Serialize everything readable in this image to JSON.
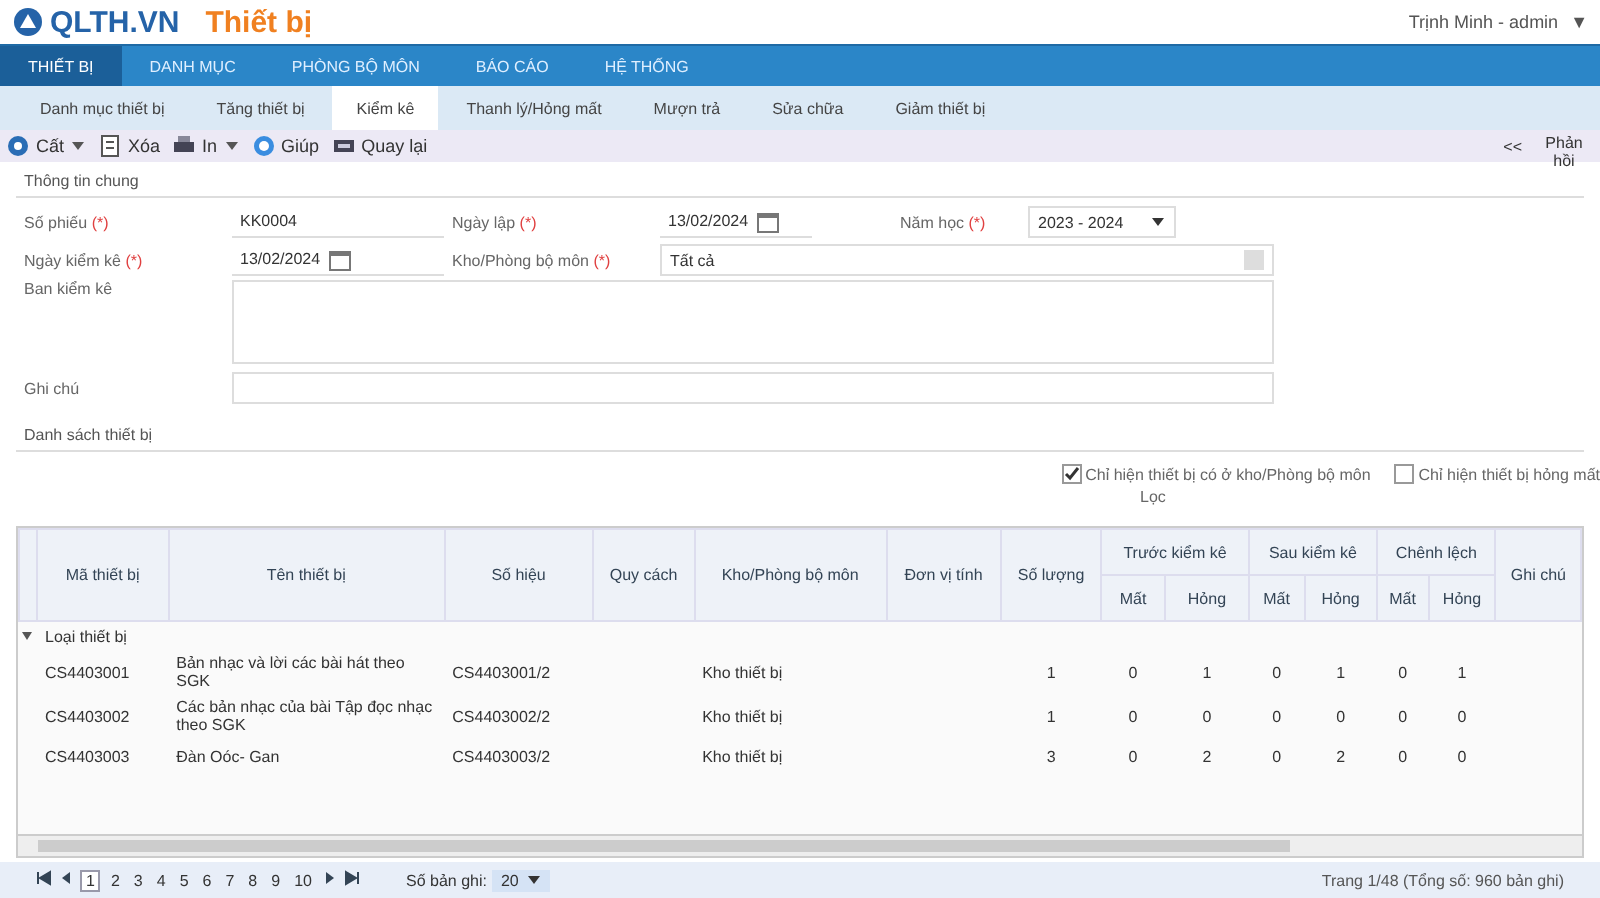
{
  "header": {
    "logo": "QLTH.VN",
    "module": "Thiết bị",
    "user": "Trịnh Minh - admin",
    "user_caret": "▼"
  },
  "nav": [
    {
      "label": "THIẾT BỊ",
      "selected": true
    },
    {
      "label": "DANH MỤC",
      "selected": false
    },
    {
      "label": "PHÒNG BỘ MÔN",
      "selected": false
    },
    {
      "label": "BÁO CÁO",
      "selected": false
    },
    {
      "label": "HỆ THỐNG",
      "selected": false
    }
  ],
  "tabs": [
    {
      "label": "Danh mục thiết bị",
      "selected": false
    },
    {
      "label": "Tăng thiết bị",
      "selected": false
    },
    {
      "label": "Kiểm kê",
      "selected": true
    },
    {
      "label": "Thanh lý/Hỏng mất",
      "selected": false
    },
    {
      "label": "Mượn trả",
      "selected": false
    },
    {
      "label": "Sửa chữa",
      "selected": false
    },
    {
      "label": "Giảm thiết bị",
      "selected": false
    }
  ],
  "toolbar": {
    "buttons": [
      {
        "label": "Cất",
        "kind": "save",
        "caret": true
      },
      {
        "label": "Xóa",
        "kind": "delete",
        "caret": false
      },
      {
        "label": "In",
        "kind": "print",
        "caret": true
      },
      {
        "label": "Giúp",
        "kind": "help",
        "caret": false
      },
      {
        "label": "Quay lại",
        "kind": "back",
        "caret": false
      }
    ],
    "collapse": "<<",
    "feedback": "Phản hồi"
  },
  "general": {
    "title": "Thông tin chung",
    "fields": [
      {
        "label": "Số phiếu",
        "required": "(*)",
        "value": "KK0004",
        "kind": "text"
      },
      {
        "label": "Ngày lập",
        "required": "(*)",
        "value": "13/02/2024",
        "kind": "date"
      },
      {
        "label": "Năm học",
        "required": "(*)",
        "value": "2023 - 2024",
        "kind": "select"
      },
      {
        "label": "Ngày kiểm kê",
        "required": "(*)",
        "value": "13/02/2024",
        "kind": "date"
      },
      {
        "label": "Kho/Phòng bộ môn",
        "required": "(*)",
        "value": "Tất cả",
        "kind": "wide"
      }
    ],
    "committee": {
      "label": "Ban kiểm kê"
    },
    "note": {
      "label": "Ghi chú"
    }
  },
  "equipment": {
    "title": "Danh sách thiết bị",
    "filters": [
      {
        "label": "Chỉ hiện thiết bị có ở kho/Phòng bộ môn",
        "checked": true
      },
      {
        "label": "Chỉ hiện thiết bị hỏng mất",
        "checked": false
      }
    ],
    "filter_link": "Lọc",
    "columns": [
      "Mã thiết bị",
      "Tên thiết bị",
      "Số hiệu",
      "Quy cách",
      "Kho/Phòng bộ môn",
      "Đơn vị tính",
      "Số lượng"
    ],
    "groups": [
      {
        "label": "Trước kiểm kê",
        "sub": [
          "Mất",
          "Hỏng"
        ]
      },
      {
        "label": "Sau kiểm kê",
        "sub": [
          "Mất",
          "Hỏng"
        ]
      },
      {
        "label": "Chênh lệch",
        "sub": [
          "Mất",
          "Hỏng"
        ]
      }
    ],
    "last_column": "Ghi chú",
    "group_row": "Loại thiết bị",
    "rows": [
      {
        "code": "CS4403001",
        "name": "Bản nhạc và lời các bài hát theo SGK",
        "serial": "CS4403001/2",
        "store": "Kho thiết bị",
        "nums": [
          "1",
          "0",
          "1",
          "0",
          "1",
          "0",
          "1"
        ]
      },
      {
        "code": "CS4403002",
        "name": "Các bản nhạc của bài Tập đọc nhạc theo SGK",
        "serial": "CS4403002/2",
        "store": "Kho thiết bị",
        "nums": [
          "1",
          "0",
          "0",
          "0",
          "0",
          "0",
          "0"
        ]
      },
      {
        "code": "CS4403003",
        "name": "Đàn Oóc- Gan",
        "serial": "CS4403003/2",
        "store": "Kho thiết bị",
        "nums": [
          "3",
          "0",
          "2",
          "0",
          "2",
          "0",
          "0"
        ]
      }
    ]
  },
  "pager": {
    "pages": [
      {
        "label": "1",
        "selected": true
      },
      {
        "label": "2",
        "selected": false
      },
      {
        "label": "3",
        "selected": false
      },
      {
        "label": "4",
        "selected": false
      },
      {
        "label": "5",
        "selected": false
      },
      {
        "label": "6",
        "selected": false
      },
      {
        "label": "7",
        "selected": false
      },
      {
        "label": "8",
        "selected": false
      },
      {
        "label": "9",
        "selected": false
      },
      {
        "label": "10",
        "selected": false
      }
    ],
    "size_label": "Số bản ghi:",
    "size": "20",
    "summary": "Trang 1/48 (Tổng số: 960 bản ghi)"
  }
}
